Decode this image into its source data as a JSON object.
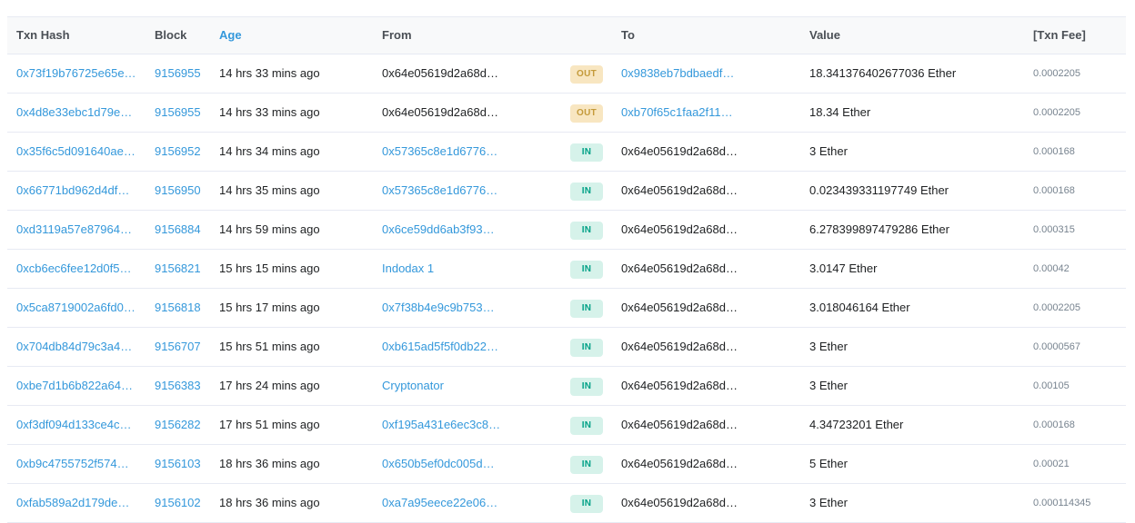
{
  "table": {
    "headers": {
      "txn_hash": "Txn Hash",
      "block": "Block",
      "age": "Age",
      "from": "From",
      "to": "To",
      "value": "Value",
      "txn_fee": "[Txn Fee]"
    },
    "rows": [
      {
        "hash": "0x73f19b76725e65e…",
        "block": "9156955",
        "age": "14 hrs 33 mins ago",
        "from": "0x64e05619d2a68d…",
        "from_is_link": false,
        "direction": "OUT",
        "to": "0x9838eb7bdbaedf…",
        "to_is_link": true,
        "value": "18.341376402677036 Ether",
        "fee": "0.0002205"
      },
      {
        "hash": "0x4d8e33ebc1d79e…",
        "block": "9156955",
        "age": "14 hrs 33 mins ago",
        "from": "0x64e05619d2a68d…",
        "from_is_link": false,
        "direction": "OUT",
        "to": "0xb70f65c1faa2f11…",
        "to_is_link": true,
        "value": "18.34 Ether",
        "fee": "0.0002205"
      },
      {
        "hash": "0x35f6c5d091640ae…",
        "block": "9156952",
        "age": "14 hrs 34 mins ago",
        "from": "0x57365c8e1d6776…",
        "from_is_link": true,
        "direction": "IN",
        "to": "0x64e05619d2a68d…",
        "to_is_link": false,
        "value": "3 Ether",
        "fee": "0.000168"
      },
      {
        "hash": "0x66771bd962d4df…",
        "block": "9156950",
        "age": "14 hrs 35 mins ago",
        "from": "0x57365c8e1d6776…",
        "from_is_link": true,
        "direction": "IN",
        "to": "0x64e05619d2a68d…",
        "to_is_link": false,
        "value": "0.023439331197749 Ether",
        "fee": "0.000168"
      },
      {
        "hash": "0xd3119a57e87964…",
        "block": "9156884",
        "age": "14 hrs 59 mins ago",
        "from": "0x6ce59dd6ab3f93…",
        "from_is_link": true,
        "direction": "IN",
        "to": "0x64e05619d2a68d…",
        "to_is_link": false,
        "value": "6.278399897479286 Ether",
        "fee": "0.000315"
      },
      {
        "hash": "0xcb6ec6fee12d0f5…",
        "block": "9156821",
        "age": "15 hrs 15 mins ago",
        "from": "Indodax 1",
        "from_is_link": true,
        "direction": "IN",
        "to": "0x64e05619d2a68d…",
        "to_is_link": false,
        "value": "3.0147 Ether",
        "fee": "0.00042"
      },
      {
        "hash": "0x5ca8719002a6fd0…",
        "block": "9156818",
        "age": "15 hrs 17 mins ago",
        "from": "0x7f38b4e9c9b753…",
        "from_is_link": true,
        "direction": "IN",
        "to": "0x64e05619d2a68d…",
        "to_is_link": false,
        "value": "3.018046164 Ether",
        "fee": "0.0002205"
      },
      {
        "hash": "0x704db84d79c3a4…",
        "block": "9156707",
        "age": "15 hrs 51 mins ago",
        "from": "0xb615ad5f5f0db22…",
        "from_is_link": true,
        "direction": "IN",
        "to": "0x64e05619d2a68d…",
        "to_is_link": false,
        "value": "3 Ether",
        "fee": "0.0000567"
      },
      {
        "hash": "0xbe7d1b6b822a64…",
        "block": "9156383",
        "age": "17 hrs 24 mins ago",
        "from": "Cryptonator",
        "from_is_link": true,
        "direction": "IN",
        "to": "0x64e05619d2a68d…",
        "to_is_link": false,
        "value": "3 Ether",
        "fee": "0.00105"
      },
      {
        "hash": "0xf3df094d133ce4c…",
        "block": "9156282",
        "age": "17 hrs 51 mins ago",
        "from": "0xf195a431e6ec3c8…",
        "from_is_link": true,
        "direction": "IN",
        "to": "0x64e05619d2a68d…",
        "to_is_link": false,
        "value": "4.34723201 Ether",
        "fee": "0.000168"
      },
      {
        "hash": "0xb9c4755752f574…",
        "block": "9156103",
        "age": "18 hrs 36 mins ago",
        "from": "0x650b5ef0dc005d…",
        "from_is_link": true,
        "direction": "IN",
        "to": "0x64e05619d2a68d…",
        "to_is_link": false,
        "value": "5 Ether",
        "fee": "0.00021"
      },
      {
        "hash": "0xfab589a2d179de…",
        "block": "9156102",
        "age": "18 hrs 36 mins ago",
        "from": "0xa7a95eece22e06…",
        "from_is_link": true,
        "direction": "IN",
        "to": "0x64e05619d2a68d…",
        "to_is_link": false,
        "value": "3 Ether",
        "fee": "0.000114345"
      }
    ]
  },
  "colors": {
    "link": "#3498db",
    "out_badge_bg": "#f8e6c1",
    "out_badge_text": "#c49a3a",
    "in_badge_bg": "#d6f2ea",
    "in_badge_text": "#00a186",
    "header_bg": "#f8f9fa",
    "border": "#e7eaf3"
  }
}
